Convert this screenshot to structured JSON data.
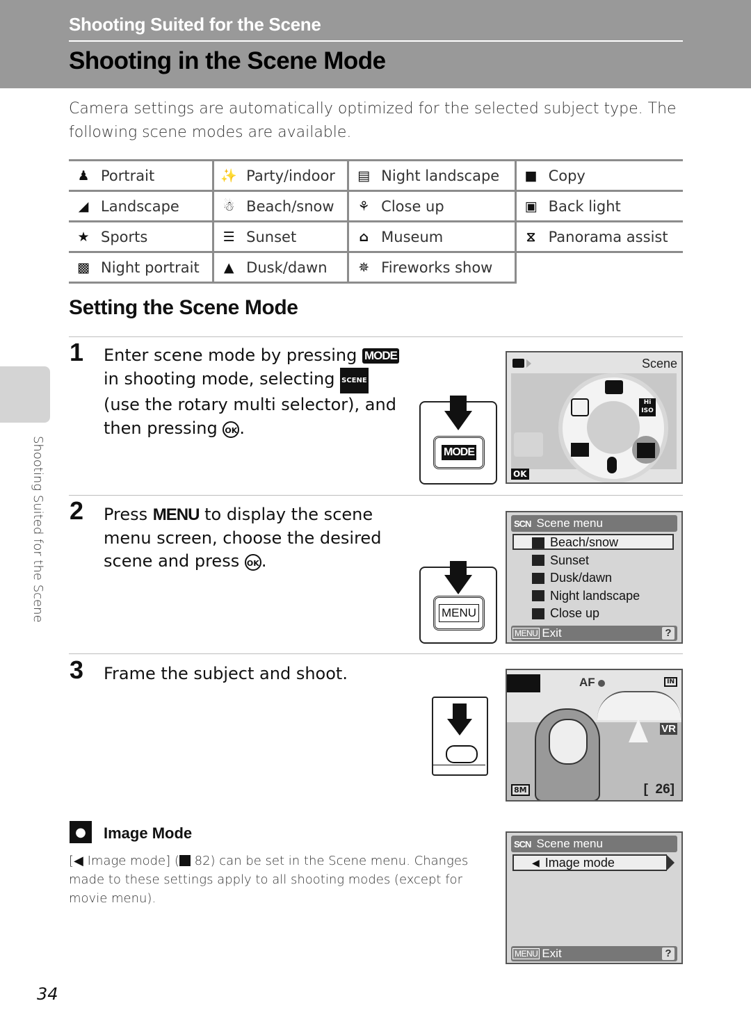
{
  "header": {
    "section": "Shooting Suited for the Scene",
    "title": "Shooting in the Scene Mode"
  },
  "intro": "Camera settings are automatically optimized for the selected subject type. The following scene modes are available.",
  "scene_table": [
    [
      {
        "icon": "portrait-icon",
        "glyph": "♟",
        "label": "Portrait"
      },
      {
        "icon": "party-indoor-icon",
        "glyph": "✨",
        "label": "Party/indoor"
      },
      {
        "icon": "night-landscape-icon",
        "glyph": "▤",
        "label": "Night landscape"
      },
      {
        "icon": "copy-icon",
        "glyph": "■",
        "label": "Copy"
      }
    ],
    [
      {
        "icon": "landscape-icon",
        "glyph": "◢",
        "label": "Landscape"
      },
      {
        "icon": "beach-snow-icon",
        "glyph": "☃",
        "label": "Beach/snow"
      },
      {
        "icon": "close-up-icon",
        "glyph": "⚘",
        "label": "Close up"
      },
      {
        "icon": "back-light-icon",
        "glyph": "▣",
        "label": "Back light"
      }
    ],
    [
      {
        "icon": "sports-icon",
        "glyph": "★",
        "label": "Sports"
      },
      {
        "icon": "sunset-icon",
        "glyph": "☰",
        "label": "Sunset"
      },
      {
        "icon": "museum-icon",
        "glyph": "⌂",
        "label": "Museum"
      },
      {
        "icon": "panorama-assist-icon",
        "glyph": "⧖",
        "label": "Panorama assist"
      }
    ],
    [
      {
        "icon": "night-portrait-icon",
        "glyph": "▩",
        "label": "Night portrait"
      },
      {
        "icon": "dusk-dawn-icon",
        "glyph": "▲",
        "label": "Dusk/dawn"
      },
      {
        "icon": "fireworks-show-icon",
        "glyph": "✵",
        "label": "Fireworks show"
      },
      null
    ]
  ],
  "section_title": "Setting the Scene Mode",
  "steps": [
    {
      "num": "1",
      "t1": "Enter scene mode by pressing ",
      "mode": "MODE",
      "t2": " in shooting mode, selecting ",
      "scene": "SCENE",
      "t3": " (use the rotary multi selector), and then pressing ",
      "ok": "OK",
      "t4": "."
    },
    {
      "num": "2",
      "t1": "Press ",
      "menu": "MENU",
      "t2": " to display the scene menu screen, choose the desired scene and press ",
      "ok": "OK",
      "t3": "."
    },
    {
      "num": "3",
      "t1": "Frame the subject and shoot."
    }
  ],
  "buttons": {
    "mode": "MODE",
    "menu": "MENU"
  },
  "screen1": {
    "label": "Scene",
    "ok": "OK",
    "dial": [
      "Auto",
      "Hi ISO",
      "Scene",
      "Voice recording",
      "Movie",
      "Setup"
    ]
  },
  "scene_menu": {
    "title_tag": "SCN",
    "title": "Scene menu",
    "items": [
      "Beach/snow",
      "Sunset",
      "Dusk/dawn",
      "Night landscape",
      "Close up"
    ],
    "selected": "Beach/snow",
    "footer_tag": "MENU",
    "footer": "Exit",
    "help": "?"
  },
  "screen3": {
    "af": "AF",
    "memory": "IN",
    "vr": "VR",
    "size": "8M",
    "shots": "[  26]"
  },
  "note": {
    "title": "Image Mode",
    "b1": "[",
    "b2": " Image mode] (",
    "b3": " 82) can be set in the Scene menu. Changes made to these settings apply to all shooting modes (except for movie menu)."
  },
  "image_menu": {
    "title_tag": "SCN",
    "title": "Scene menu",
    "item": "Image mode",
    "footer_tag": "MENU",
    "footer": "Exit",
    "help": "?"
  },
  "side_tab": "Shooting Suited for the Scene",
  "page_number": "34"
}
